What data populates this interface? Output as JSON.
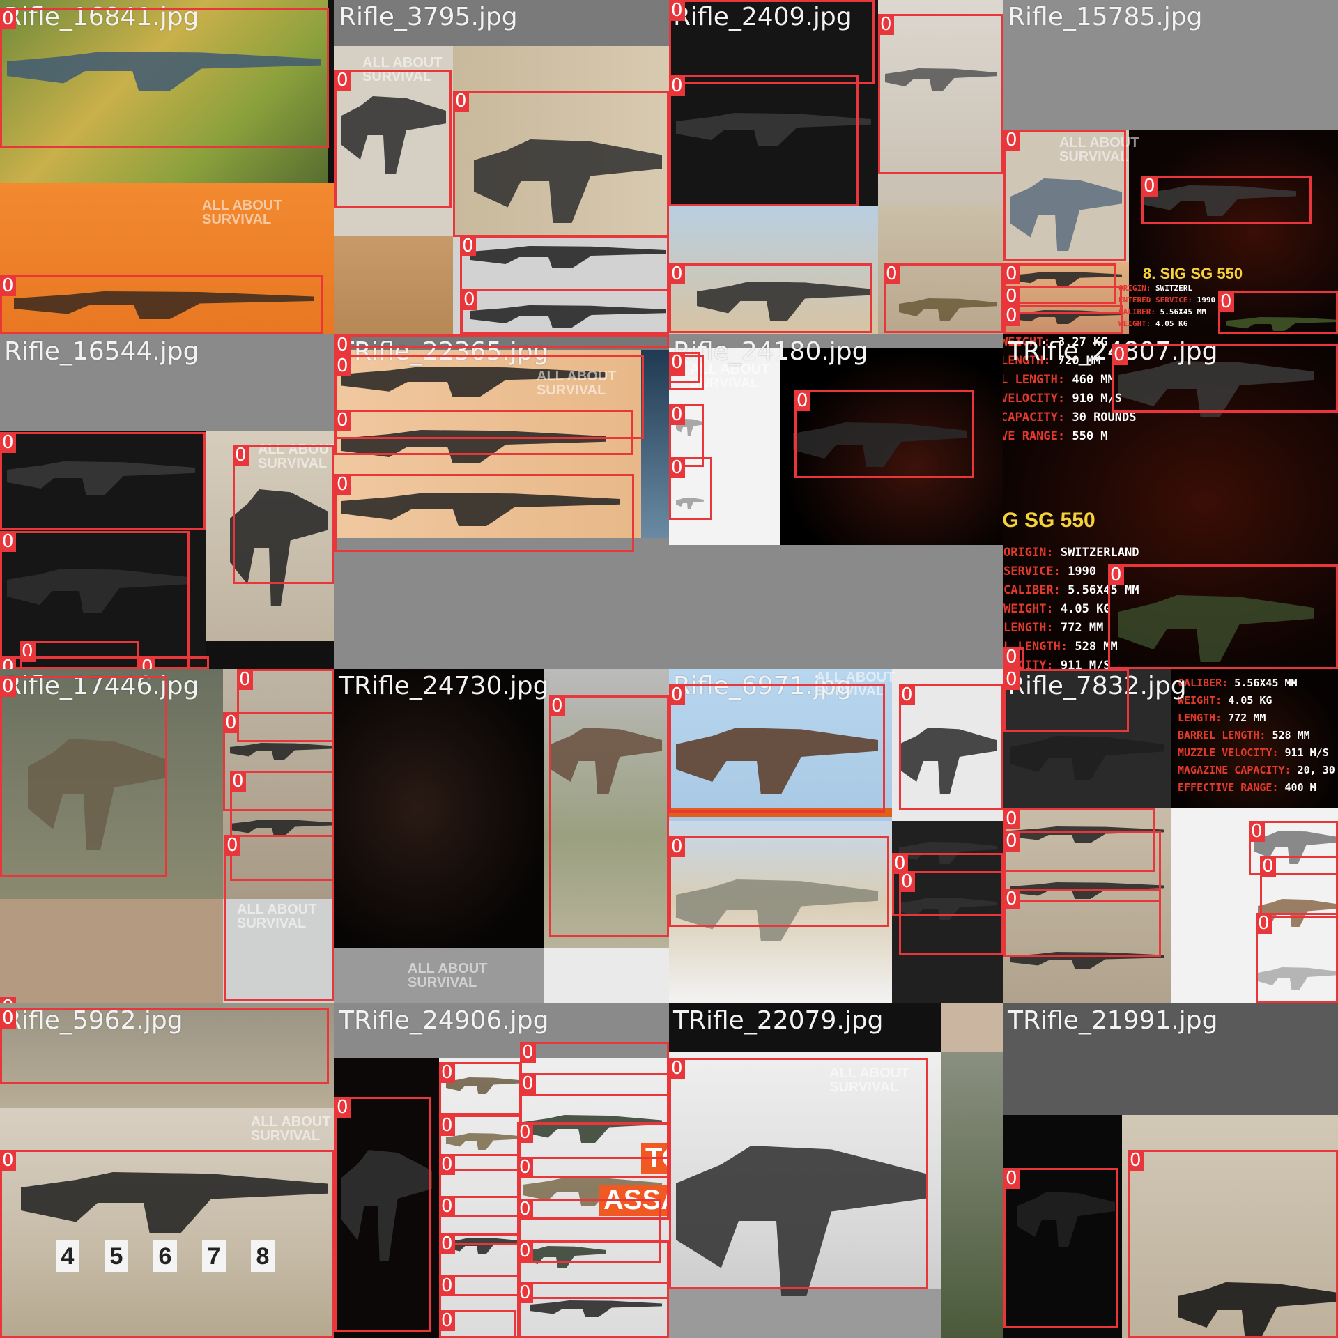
{
  "mosaic": {
    "class_label": "0",
    "colors": {
      "box": "#e8363a",
      "title": "#f2f2f2",
      "padding": "#808080"
    },
    "tiles": [
      {
        "title": "Rifle_16841.jpg",
        "box_count": 2,
        "logo": "ALL ABOUT\nSURVIVAL"
      },
      {
        "title": "Rifle_3795.jpg",
        "box_count": 4,
        "logo": "ALL ABOUT\nSURVIVAL"
      },
      {
        "title": "Rifle_2409.jpg",
        "box_count": 5,
        "logo": ""
      },
      {
        "title": "Rifle_15785.jpg",
        "box_count": 6,
        "logo": "ALL ABOUT\nSURVIVAL",
        "overlay": {
          "heading": "8. SIG SG 550",
          "lines": [
            [
              "ORIGIN:",
              "SWITZERL"
            ],
            [
              "ENTERED SERVICE:",
              "1990"
            ],
            [
              "CALIBER:",
              "5.56X45 MM"
            ],
            [
              "WEIGHT:",
              "4.05 KG"
            ]
          ]
        }
      },
      {
        "title": "Rifle_16544.jpg",
        "box_count": 6,
        "logo": "ALL ABOUT\nSURVIVAL"
      },
      {
        "title": "TRifle_22365.jpg",
        "box_count": 4,
        "logo": "ALL ABOUT\nSURVIVAL"
      },
      {
        "title": "Rifle_24180.jpg",
        "box_count": 5,
        "logo": "ALL ABOUT\nSURVIVAL"
      },
      {
        "title": "TRifle_24807.jpg",
        "box_count": 3,
        "overlay": {
          "top_lines": [
            [
              "WEIGHT:",
              "3.27 KG"
            ],
            [
              "LENGTH:",
              "720 MM"
            ],
            [
              "L LENGTH:",
              "460 MM"
            ],
            [
              "VELOCITY:",
              "910 M/S"
            ],
            [
              "CAPACITY:",
              "30 ROUNDS"
            ],
            [
              "VE RANGE:",
              "550 M"
            ]
          ],
          "heading": "IG SG 550",
          "lines": [
            [
              "ORIGIN:",
              "SWITZERLAND"
            ],
            [
              "SERVICE:",
              "1990"
            ],
            [
              "CALIBER:",
              "5.56X45 MM"
            ],
            [
              "WEIGHT:",
              "4.05 KG"
            ],
            [
              "LENGTH:",
              "772 MM"
            ],
            [
              "L LENGTH:",
              "528 MM"
            ],
            [
              "LOCITY:",
              "911 M/S"
            ]
          ]
        }
      },
      {
        "title": "Rifle_17446.jpg",
        "box_count": 6,
        "logo": "ALL ABOUT\nSURVIVAL"
      },
      {
        "title": "TRifle_24730.jpg",
        "box_count": 1,
        "logo": "ALL ABOUT\nSURVIVAL"
      },
      {
        "title": "Rifle_6971.jpg",
        "box_count": 5,
        "logo": "ALL ABOUT\nSURVIVAL"
      },
      {
        "title": "Rifle_7832.jpg",
        "box_count": 7,
        "overlay": {
          "lines": [
            [
              "CALIBER:",
              "5.56X45 MM"
            ],
            [
              "WEIGHT:",
              "4.05 KG"
            ],
            [
              "LENGTH:",
              "772 MM"
            ],
            [
              "BARREL LENGTH:",
              "528 MM"
            ],
            [
              "MUZZLE VELOCITY:",
              "911 M/S"
            ],
            [
              "MAGAZINE CAPACITY:",
              "20, 30 ROUND"
            ],
            [
              "EFFECTIVE RANGE:",
              "400 M"
            ]
          ]
        }
      },
      {
        "title": "Rifle_5962.jpg",
        "box_count": 2,
        "logo": "ALL ABOUT\nSURVIVAL",
        "lane_numbers": [
          "4",
          "5",
          "6",
          "7",
          "8"
        ]
      },
      {
        "title": "TRifle_24906.jpg",
        "box_count": 15,
        "promo": [
          "TO",
          "ASSAU"
        ]
      },
      {
        "title": "TRifle_22079.jpg",
        "box_count": 1,
        "logo": "ALL ABOUT\nSURVIVAL"
      },
      {
        "title": "TRifle_21991.jpg",
        "box_count": 2
      }
    ]
  }
}
